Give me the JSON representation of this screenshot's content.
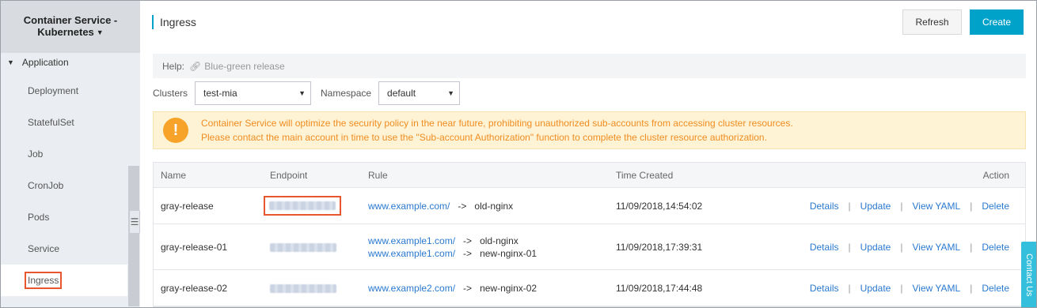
{
  "sidebar": {
    "brand_line1": "Container Service -",
    "brand_line2": "Kubernetes",
    "section": "Application",
    "items": [
      {
        "label": "Deployment"
      },
      {
        "label": "StatefulSet"
      },
      {
        "label": "Job"
      },
      {
        "label": "CronJob"
      },
      {
        "label": "Pods"
      },
      {
        "label": "Service"
      },
      {
        "label": "Ingress"
      }
    ],
    "active_item": "Ingress"
  },
  "header": {
    "title": "Ingress",
    "refresh_label": "Refresh",
    "create_label": "Create"
  },
  "help": {
    "label": "Help:",
    "link_text": "Blue-green release"
  },
  "filters": {
    "clusters_label": "Clusters",
    "clusters_value": "test-mia",
    "namespace_label": "Namespace",
    "namespace_value": "default"
  },
  "warning": {
    "line1": "Container Service will optimize the security policy in the near future, prohibiting unauthorized sub-accounts from accessing cluster resources.",
    "line2": "Please contact the main account in time to use the \"Sub-account Authorization\" function to complete the cluster resource authorization."
  },
  "table": {
    "columns": {
      "name": "Name",
      "endpoint": "Endpoint",
      "rule": "Rule",
      "time": "Time Created",
      "action": "Action"
    },
    "actions": {
      "details": "Details",
      "update": "Update",
      "view_yaml": "View YAML",
      "delete": "Delete",
      "separator": "|"
    },
    "rule_arrow": "->",
    "rows": [
      {
        "name": "gray-release",
        "rules": [
          {
            "host": "www.example.com/",
            "service": "old-nginx"
          }
        ],
        "time": "11/09/2018,14:54:02"
      },
      {
        "name": "gray-release-01",
        "rules": [
          {
            "host": "www.example1.com/",
            "service": "old-nginx"
          },
          {
            "host": "www.example1.com/",
            "service": "new-nginx-01"
          }
        ],
        "time": "11/09/2018,17:39:31"
      },
      {
        "name": "gray-release-02",
        "rules": [
          {
            "host": "www.example2.com/",
            "service": "new-nginx-02"
          }
        ],
        "time": "11/09/2018,17:44:48"
      }
    ]
  },
  "contact_us": "Contact Us",
  "colors": {
    "accent": "#00a2ca",
    "link": "#2a79d0",
    "warning_text": "#f08c1f",
    "highlight_box": "#e8562f"
  },
  "icons": {
    "collapse_arrow": "triangle-down-icon",
    "help_link": "link-icon",
    "warning": "exclamation-icon",
    "sidebar_toggle": "menu-collapse-icon"
  }
}
